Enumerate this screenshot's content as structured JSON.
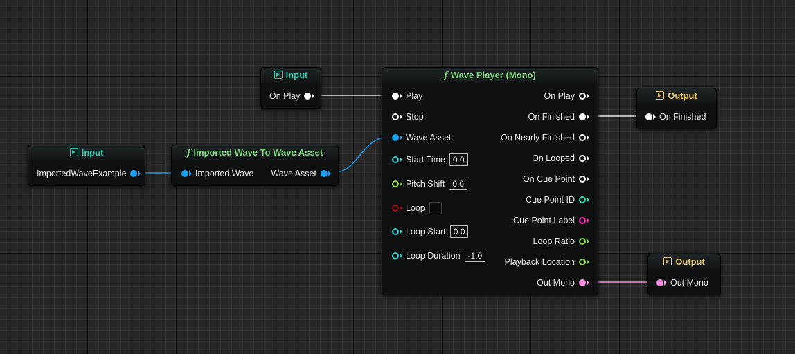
{
  "colors": {
    "trigger": "#ffffff",
    "wave_asset": "#1aa0f0",
    "time": "#2bd1d1",
    "float": "#86d945",
    "bool": "#a30d0d",
    "int": "#2ae0b5",
    "string": "#ff2bb8",
    "audio": "#ff8ce0",
    "header_input": "#2ec9b3",
    "header_function": "#7ed27e",
    "header_output": "#e3c568"
  },
  "nodes": {
    "input_on_play": {
      "title": "Input",
      "icon": "input-icon",
      "out_pin": {
        "label": "On Play",
        "type": "trigger"
      }
    },
    "input_imported": {
      "title": "Input",
      "icon": "input-icon",
      "out_pin": {
        "label": "ImportedWaveExample",
        "type": "wave_asset"
      }
    },
    "imported_wave_to_asset": {
      "title": "Imported Wave To Wave Asset",
      "icon": "function-icon",
      "glyph": "ƒ",
      "in_pin": {
        "label": "Imported Wave",
        "type": "wave_asset"
      },
      "out_pin": {
        "label": "Wave Asset",
        "type": "wave_asset"
      }
    },
    "wave_player": {
      "title": "Wave Player (Mono)",
      "icon": "function-icon",
      "glyph": "ƒ",
      "inputs": [
        {
          "label": "Play",
          "type": "trigger",
          "filled": true
        },
        {
          "label": "Stop",
          "type": "trigger",
          "filled": false
        },
        {
          "label": "Wave Asset",
          "type": "wave_asset",
          "filled": true
        },
        {
          "label": "Start Time",
          "type": "time",
          "filled": false,
          "value": "0.0"
        },
        {
          "label": "Pitch Shift",
          "type": "float",
          "filled": false,
          "value": "0.0"
        },
        {
          "label": "Loop",
          "type": "bool",
          "filled": false,
          "checkbox": true
        },
        {
          "label": "Loop Start",
          "type": "time",
          "filled": false,
          "value": "0.0"
        },
        {
          "label": "Loop Duration",
          "type": "time",
          "filled": false,
          "value": "-1.0"
        }
      ],
      "outputs": [
        {
          "label": "On Play",
          "type": "trigger",
          "filled": false
        },
        {
          "label": "On Finished",
          "type": "trigger",
          "filled": true
        },
        {
          "label": "On Nearly Finished",
          "type": "trigger",
          "filled": false
        },
        {
          "label": "On Looped",
          "type": "trigger",
          "filled": false
        },
        {
          "label": "On Cue Point",
          "type": "trigger",
          "filled": false
        },
        {
          "label": "Cue Point ID",
          "type": "int",
          "filled": false
        },
        {
          "label": "Cue Point Label",
          "type": "string",
          "filled": false
        },
        {
          "label": "Loop Ratio",
          "type": "float",
          "filled": false
        },
        {
          "label": "Playback Location",
          "type": "float",
          "filled": false
        },
        {
          "label": "Out Mono",
          "type": "audio",
          "filled": true
        }
      ]
    },
    "output_on_finished": {
      "title": "Output",
      "icon": "output-icon",
      "in_pin": {
        "label": "On Finished",
        "type": "trigger"
      }
    },
    "output_out_mono": {
      "title": "Output",
      "icon": "output-icon",
      "in_pin": {
        "label": "Out Mono",
        "type": "audio"
      }
    }
  }
}
